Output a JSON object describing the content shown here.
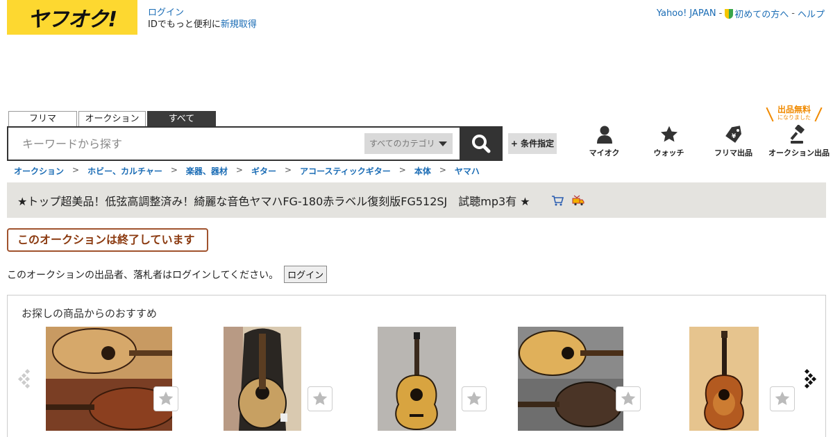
{
  "header": {
    "logo_text": "ヤフオク!",
    "login_link": "ログイン",
    "login_line2_prefix": "IDでもっと便利に",
    "signup_link": "新規取得",
    "top_links": [
      "Yahoo! JAPAN",
      "初めての方へ",
      "ヘルプ"
    ],
    "separator": "-"
  },
  "free_badge": {
    "line1": "出品無料",
    "line2": "になりました"
  },
  "search": {
    "tabs": [
      "フリマ",
      "オークション",
      "すべて"
    ],
    "active_tab": "すべて",
    "placeholder": "キーワードから探す",
    "category": "すべてのカテゴリ",
    "condition_button": "+ 条件指定"
  },
  "nav": [
    {
      "label": "マイオク",
      "icon": "person-icon"
    },
    {
      "label": "ウォッチ",
      "icon": "star-icon"
    },
    {
      "label": "フリマ出品",
      "icon": "price-tag-icon"
    },
    {
      "label": "オークション出品",
      "icon": "gavel-icon"
    }
  ],
  "breadcrumb": [
    "オークション",
    "ホビー、カルチャー",
    "楽器、器材",
    "ギター",
    "アコースティックギター",
    "本体",
    "ヤマハ"
  ],
  "item": {
    "title": "★トップ超美品！低弦高調整済み！綺麗な音色ヤマハFG-180赤ラベル復刻版FG512SJ　試聴mp3有 ★",
    "ended_message": "このオークションは終了しています",
    "login_note": "このオークションの出品者、落札者はログインしてください。",
    "login_button": "ログイン"
  },
  "recommend": {
    "heading": "お探しの商品からのおすすめ",
    "items": [
      {
        "name": "guitar-product-1"
      },
      {
        "name": "guitar-product-2"
      },
      {
        "name": "guitar-product-3"
      },
      {
        "name": "guitar-product-4"
      },
      {
        "name": "guitar-product-5"
      }
    ]
  },
  "colors": {
    "brand_yellow": "#fdd830",
    "link_blue": "#1a6cb5",
    "ended_brown": "#8b3a10",
    "title_bg": "#e4e3df",
    "free_orange": "#f08a00"
  }
}
